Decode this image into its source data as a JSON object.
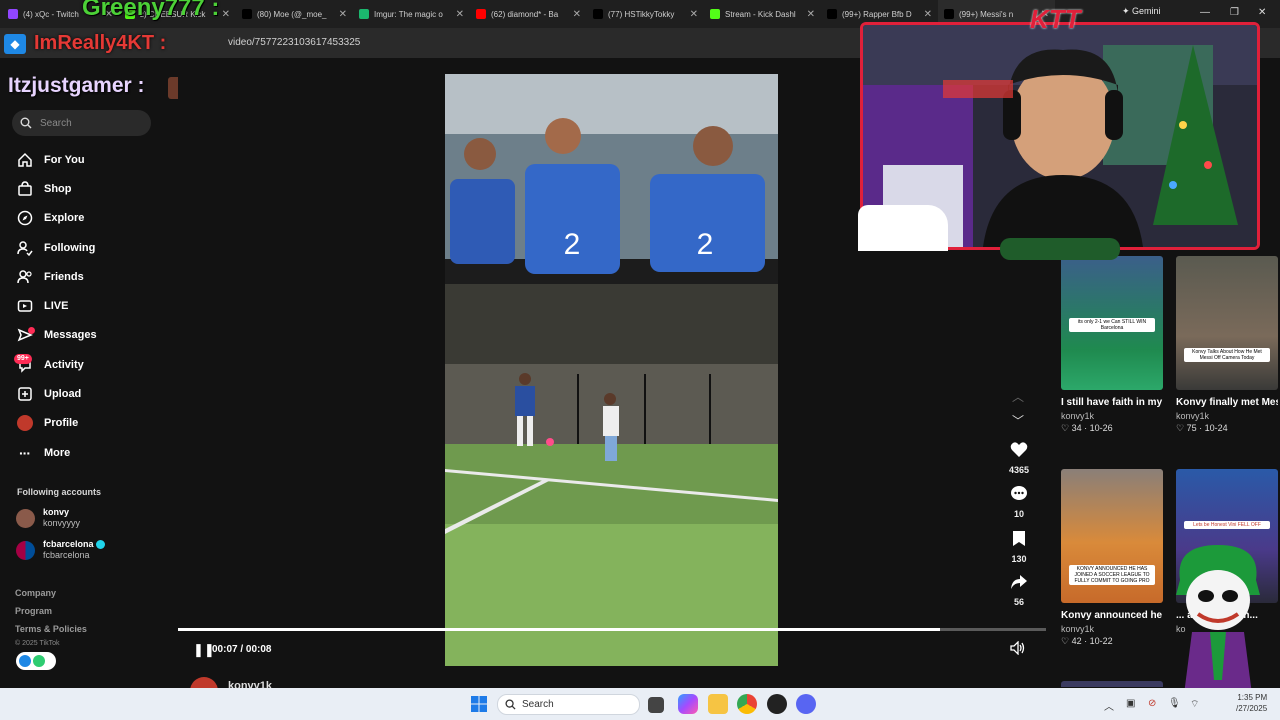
{
  "browser": {
    "tabs": [
      {
        "title": "(4) xQc - Twitch",
        "color": "#9146ff"
      },
      {
        "title": "z) CHEESUR Kick",
        "color": "#53fc18"
      },
      {
        "title": "(80) Moe (@_moe_",
        "color": "#000000"
      },
      {
        "title": "Imgur: The magic o",
        "color": "#1bb76e"
      },
      {
        "title": "(62) diamond* - Ba",
        "color": "#ff0000"
      },
      {
        "title": "(77) HSTikkyTokky",
        "color": "#000000"
      },
      {
        "title": "Stream - Kick Dashl",
        "color": "#53fc18"
      },
      {
        "title": "(99+) Rapper Bfb D",
        "color": "#000000"
      },
      {
        "title": "(99+) Messi's n",
        "color": "#000000"
      }
    ],
    "gemini_label": "Gemini",
    "url": "video/7577223103617453325"
  },
  "overlays": {
    "greeny": "Greeny777 :",
    "imreally": "ImReally4KT :",
    "itzjust": "Itzjustgamer :",
    "ktt": "KTT"
  },
  "sidebar": {
    "search_placeholder": "Search",
    "nav": [
      {
        "label": "For You",
        "icon": "home-icon"
      },
      {
        "label": "Shop",
        "icon": "shop-icon"
      },
      {
        "label": "Explore",
        "icon": "compass-icon"
      },
      {
        "label": "Following",
        "icon": "following-icon"
      },
      {
        "label": "Friends",
        "icon": "friends-icon"
      },
      {
        "label": "LIVE",
        "icon": "live-icon"
      },
      {
        "label": "Messages",
        "icon": "messages-icon"
      },
      {
        "label": "Activity",
        "icon": "activity-icon"
      },
      {
        "label": "Upload",
        "icon": "upload-icon"
      },
      {
        "label": "Profile",
        "icon": "profile-icon"
      },
      {
        "label": "More",
        "icon": "more-icon"
      }
    ],
    "activity_badge": "99+",
    "following_header": "Following accounts",
    "following": [
      {
        "name": "konvy",
        "handle": "konvyyyy"
      },
      {
        "name": "fcbarcelona",
        "handle": "fcbarcelona"
      }
    ],
    "footer": [
      "Company",
      "Program",
      "Terms & Policies"
    ],
    "copyright": "© 2025 TikTok"
  },
  "player": {
    "time": "00:07 / 00:08",
    "progress": 0.878,
    "author": "konvy1k",
    "likes": "4365",
    "comments": "10",
    "saves": "130",
    "shares": "56"
  },
  "recommendations": [
    {
      "caption": "I still have faith in my team #fyp #Soccer...",
      "author": "konvy1k",
      "views": "34",
      "date": "10-26",
      "tag": "its only 2-1 we Can STILL WIN Barcelona"
    },
    {
      "caption": "Konvy finally met Messi 🔥 #fyp...",
      "author": "konvy1k",
      "views": "75",
      "date": "10-24",
      "tag": "Konvy Talks About How He Met Messi Off Camera Today"
    },
    {
      "caption": "Konvy announced he has joined a soccer...",
      "author": "konvy1k",
      "views": "42",
      "date": "10-22",
      "tag": "KONVY ANNOUNCED HE HAS JOINED A SOCCER LEAGUE TO FULLY COMMIT TO GOING PRO"
    },
    {
      "caption": "... as he w... tbh...",
      "author": "ko",
      "views": "",
      "date": "",
      "tag": "Lets be Honest Vini FELL OFF"
    }
  ],
  "taskbar": {
    "search_placeholder": "Search",
    "time": "1:35 PM",
    "date": "/27/2025"
  }
}
